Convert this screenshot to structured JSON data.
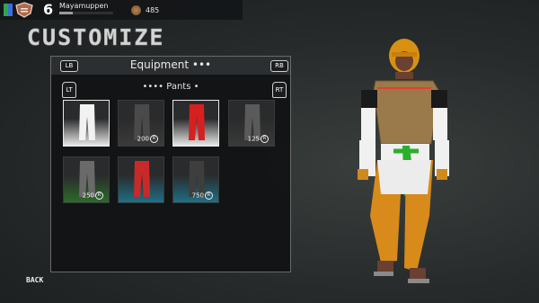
{
  "player": {
    "level": "6",
    "name": "Mayamuppen",
    "coins": "485",
    "xp_fraction": 0.25
  },
  "screen": {
    "title": "CUSTOMIZE",
    "back_label": "BACK"
  },
  "panel": {
    "title": "Equipment •••",
    "lb": "LB",
    "rb": "RB",
    "lt": "LT",
    "rt": "RT",
    "category": "•••• Pants •"
  },
  "items": [
    {
      "price": "",
      "pants_color": "#f2f2f2",
      "bg": "#e8e8e8",
      "selected": true
    },
    {
      "price": "200",
      "pants_color": "#4a4a4a",
      "bg": "#3a3a3a",
      "selected": false
    },
    {
      "price": "",
      "pants_color": "#d62020",
      "bg": "#e8e8e8",
      "selected": true
    },
    {
      "price": "125",
      "pants_color": "#5a5a5a",
      "bg": "#3a3a3a",
      "selected": false
    },
    {
      "price": "250",
      "pants_color": "#6a6a6a",
      "bg": "#2c6a2c",
      "selected": false
    },
    {
      "price": "",
      "pants_color": "#c82a2a",
      "bg": "#1f6f86",
      "selected": false
    },
    {
      "price": "750",
      "pants_color": "#3e3e3e",
      "bg": "#1f6f86",
      "selected": false
    }
  ],
  "currency_symbol": "R",
  "colors": {
    "accent_green": "#2aa84a",
    "accent_blue": "#3b6de0"
  }
}
